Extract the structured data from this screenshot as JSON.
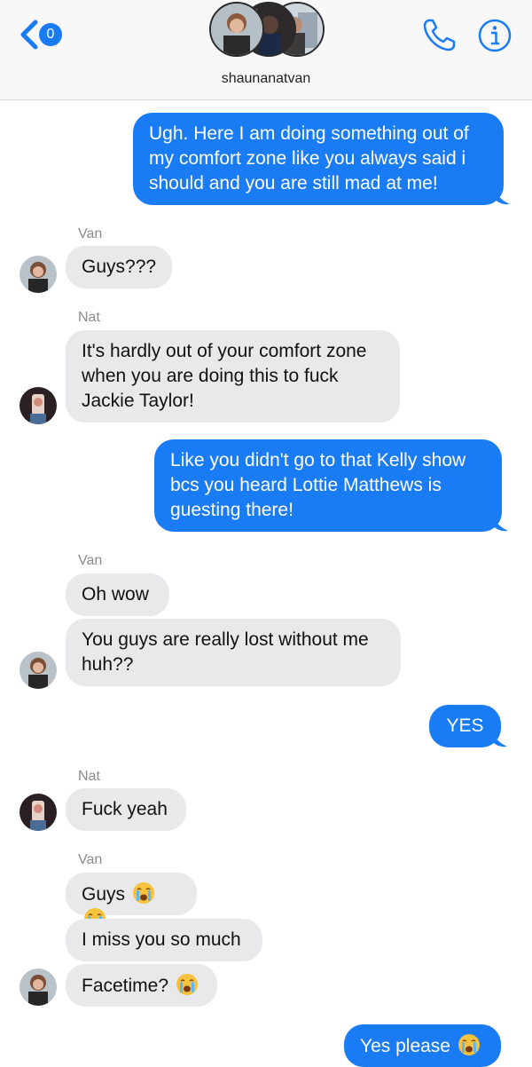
{
  "header": {
    "back_badge": "0",
    "group_name": "shaunanatvan"
  },
  "messages": [
    {
      "type": "sent",
      "text": "Ugh. Here I am doing something out of my comfort zone like you always said i should and you are still mad at me!"
    },
    {
      "type": "sender",
      "text": "Van"
    },
    {
      "type": "recv",
      "text": "Guys???"
    },
    {
      "type": "sender",
      "text": "Nat"
    },
    {
      "type": "recv",
      "text": "It's hardly out of your comfort zone when you are doing this to fuck Jackie Taylor!"
    },
    {
      "type": "sent",
      "text": "Like you didn't go to that Kelly show bcs you heard Lottie Matthews is guesting there!"
    },
    {
      "type": "sender",
      "text": "Van"
    },
    {
      "type": "recv",
      "text": "Oh wow"
    },
    {
      "type": "recv",
      "text": "You guys are really lost without me huh??"
    },
    {
      "type": "sent",
      "text": "YES"
    },
    {
      "type": "sender",
      "text": "Nat"
    },
    {
      "type": "recv",
      "text": "Fuck yeah"
    },
    {
      "type": "sender",
      "text": "Van"
    },
    {
      "type": "recv",
      "text": "Guys"
    },
    {
      "type": "recv",
      "text": "I miss you so much"
    },
    {
      "type": "recv",
      "text": "Facetime?"
    },
    {
      "type": "sent",
      "text": "Yes please"
    }
  ],
  "colors": {
    "sent_bubble": "#1a7cf5",
    "received_bubble": "#e9e9eb",
    "accent": "#1a7cf5"
  },
  "icons": [
    "back-chevron-icon",
    "phone-icon",
    "info-icon",
    "loudly-crying-face-emoji"
  ]
}
